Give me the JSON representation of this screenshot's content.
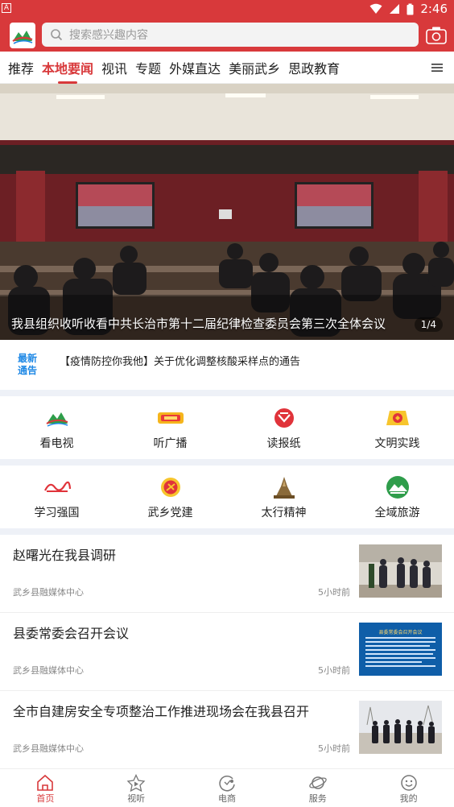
{
  "status_bar": {
    "time": "2:46",
    "left_glyph": "A"
  },
  "search": {
    "placeholder": "搜索感兴趣内容"
  },
  "tabs": [
    "推荐",
    "本地要闻",
    "视讯",
    "专题",
    "外媒直达",
    "美丽武乡",
    "思政教育"
  ],
  "active_tab": 1,
  "banner": {
    "title": "我县组织收听收看中共长治市第十二届纪律检查委员会第三次全体会议",
    "counter": "1/4"
  },
  "notice": {
    "badge_line1": "最新",
    "badge_line2": "通告",
    "text": "【疫情防控你我他】关于优化调整核酸采样点的通告"
  },
  "grid_row1": [
    {
      "label": "看电视",
      "icon": "tv-mountain-icon"
    },
    {
      "label": "听广播",
      "icon": "radio-icon"
    },
    {
      "label": "读报纸",
      "icon": "newspaper-icon"
    },
    {
      "label": "文明实践",
      "icon": "civilization-icon"
    }
  ],
  "grid_row2": [
    {
      "label": "学习强国",
      "icon": "xuexi-icon"
    },
    {
      "label": "武乡党建",
      "icon": "party-building-icon"
    },
    {
      "label": "太行精神",
      "icon": "taihang-monument-icon"
    },
    {
      "label": "全域旅游",
      "icon": "tourism-icon"
    }
  ],
  "news": [
    {
      "title": "赵曙光在我县调研",
      "source": "武乡县融媒体中心",
      "time": "5小时前"
    },
    {
      "title": "县委常委会召开会议",
      "source": "武乡县融媒体中心",
      "time": "5小时前"
    },
    {
      "title": "全市自建房安全专项整治工作推进现场会在我县召开",
      "source": "武乡县融媒体中心",
      "time": "5小时前"
    }
  ],
  "news_thumb2_heading": "县委常委会召开会议",
  "bottom_nav": [
    "首页",
    "视听",
    "电商",
    "服务",
    "我的"
  ],
  "colors": {
    "brand": "#d8393b",
    "notice_blue": "#1e88e5",
    "separator": "#eef1f7"
  }
}
